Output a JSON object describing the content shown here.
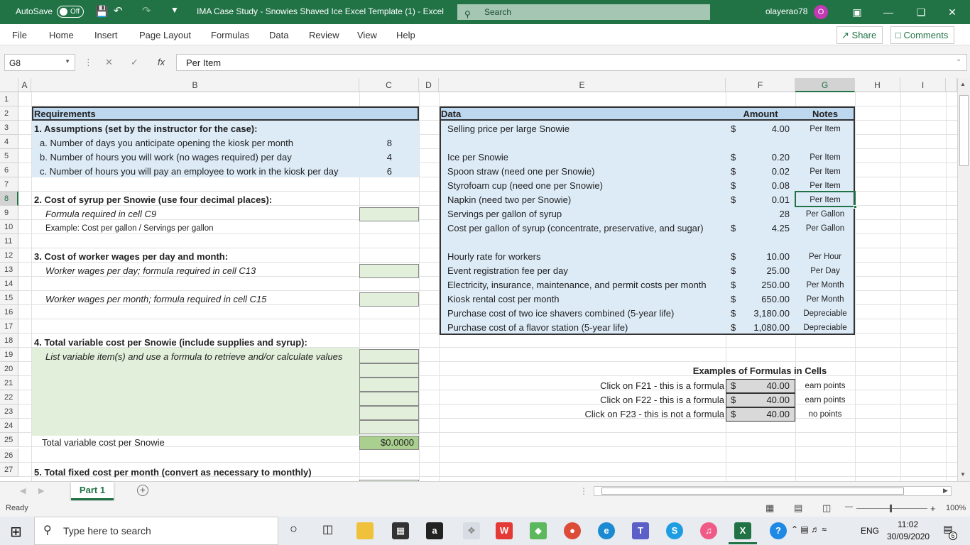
{
  "titlebar": {
    "autosave_label": "AutoSave",
    "autosave_state": "Off",
    "doc_title": "IMA Case Study - Snowies Shaved Ice Excel Template (1)",
    "app_name": "Excel",
    "search_placeholder": "Search",
    "user_name": "olayerao78",
    "user_initial": "O"
  },
  "ribbon": {
    "tabs": [
      "File",
      "Home",
      "Insert",
      "Page Layout",
      "Formulas",
      "Data",
      "Review",
      "View",
      "Help"
    ],
    "share_label": "Share",
    "comments_label": "Comments"
  },
  "formula_bar": {
    "name_box": "G8",
    "fx_label": "fx",
    "content": "Per Item"
  },
  "columns": [
    "A",
    "B",
    "C",
    "D",
    "E",
    "F",
    "G",
    "H",
    "I"
  ],
  "rows": [
    "1",
    "2",
    "3",
    "4",
    "5",
    "6",
    "7",
    "8",
    "9",
    "10",
    "11",
    "12",
    "13",
    "14",
    "15",
    "16",
    "17",
    "18",
    "19",
    "20",
    "21",
    "22",
    "23",
    "24",
    "25",
    "26",
    "27"
  ],
  "left": {
    "requirements": "Requirements",
    "assumptions": "1. Assumptions (set by the instructor for the case):",
    "a": "a. Number of days you anticipate opening the kiosk per month",
    "a_val": "8",
    "b": "b. Number of hours you will work (no wages required) per day",
    "b_val": "4",
    "c": "c. Number of hours you will pay an employee to work in the kiosk per day",
    "c_val": "6",
    "syrup": "2. Cost of syrup per Snowie (use four decimal places):",
    "syrup_formula": "Formula required in cell C9",
    "syrup_example": "Example: Cost per gallon / Servings per gallon",
    "wages": "3. Cost of worker wages per day and month:",
    "wages_day": "Worker wages per day; formula required in cell C13",
    "wages_month": "Worker wages per month; formula required in cell C15",
    "variable": "4. Total variable cost per Snowie (include supplies and syrup):",
    "variable_list": "List variable item(s) and use a formula to retrieve and/or calculate values",
    "total_variable": "Total variable cost per Snowie",
    "total_variable_val": "$0.0000",
    "fixed": "5. Total fixed cost per month (convert as necessary to monthly)"
  },
  "data_table": {
    "header": "Data",
    "amount_header": "Amount",
    "notes_header": "Notes",
    "rows": [
      {
        "label": "Selling price per large Snowie",
        "cur": "$",
        "amount": "4.00",
        "note": "Per Item"
      },
      {
        "label": "",
        "cur": "",
        "amount": "",
        "note": ""
      },
      {
        "label": "Ice per Snowie",
        "cur": "$",
        "amount": "0.20",
        "note": "Per Item"
      },
      {
        "label": "Spoon straw (need one per Snowie)",
        "cur": "$",
        "amount": "0.02",
        "note": "Per Item"
      },
      {
        "label": "Styrofoam cup (need one per Snowie)",
        "cur": "$",
        "amount": "0.08",
        "note": "Per Item"
      },
      {
        "label": "Napkin (need two per Snowie)",
        "cur": "$",
        "amount": "0.01",
        "note": "Per Item"
      },
      {
        "label": "Servings per gallon of syrup",
        "cur": "",
        "amount": "28",
        "note": "Per Gallon"
      },
      {
        "label": "Cost per gallon of syrup (concentrate, preservative, and sugar)",
        "cur": "$",
        "amount": "4.25",
        "note": "Per Gallon"
      },
      {
        "label": "",
        "cur": "",
        "amount": "",
        "note": ""
      },
      {
        "label": "Hourly rate for workers",
        "cur": "$",
        "amount": "10.00",
        "note": "Per Hour"
      },
      {
        "label": "Event registration fee per day",
        "cur": "$",
        "amount": "25.00",
        "note": "Per Day"
      },
      {
        "label": "Electricity, insurance, maintenance, and permit costs per month",
        "cur": "$",
        "amount": "250.00",
        "note": "Per Month"
      },
      {
        "label": "Kiosk rental cost per month",
        "cur": "$",
        "amount": "650.00",
        "note": "Per Month"
      },
      {
        "label": "Purchase cost of two ice shavers combined (5-year life)",
        "cur": "$",
        "amount": "3,180.00",
        "note": "Depreciable"
      },
      {
        "label": "Purchase cost of a flavor station (5-year life)",
        "cur": "$",
        "amount": "1,080.00",
        "note": "Depreciable"
      }
    ]
  },
  "examples": {
    "title": "Examples of Formulas in Cells",
    "rows": [
      {
        "label": "Click on F21 - this is a formula",
        "cur": "$",
        "amount": "40.00",
        "note": "earn points"
      },
      {
        "label": "Click on F22 - this is a formula",
        "cur": "$",
        "amount": "40.00",
        "note": "earn points"
      },
      {
        "label": "Click on F23 - this is not a formula",
        "cur": "$",
        "amount": "40.00",
        "note": "no points"
      }
    ]
  },
  "sheet_tabs": {
    "active": "Part 1"
  },
  "status": {
    "left": "Ready",
    "zoom": "100%"
  },
  "taskbar": {
    "search_placeholder": "Type here to search",
    "language": "ENG",
    "time": "11:02",
    "date": "30/09/2020",
    "notifications": "6"
  },
  "colors": {
    "excel_green": "#217346",
    "data_fill": "#ddebf7",
    "input_fill": "#e2efda"
  }
}
